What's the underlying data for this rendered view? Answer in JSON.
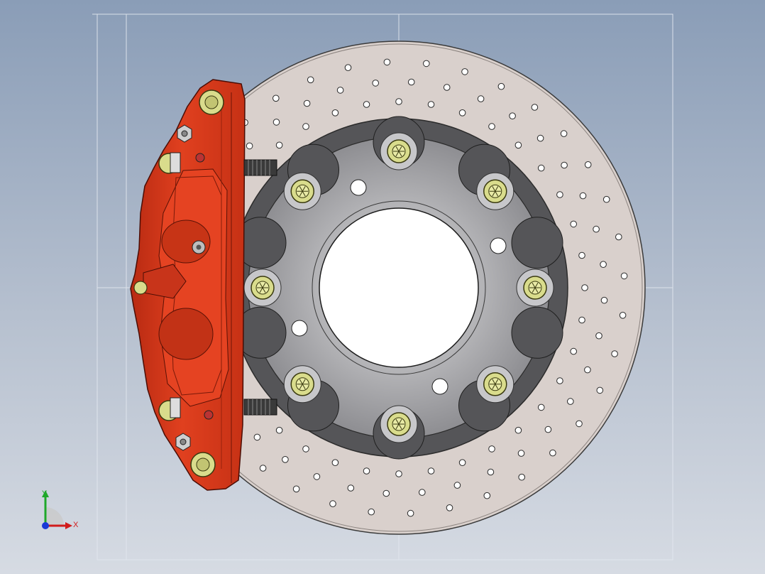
{
  "viewport": {
    "background_top": "#8a9db7",
    "background_bottom": "#d6dbe3"
  },
  "colors": {
    "caliper": "#d8371c",
    "caliper_dark": "#9b2410",
    "caliper_line": "#4a0d05",
    "rotor": "#d8cfcb",
    "rotor_edge": "#3a3a3a",
    "hat_ring": "#555558",
    "hat_face": "#a8a8ab",
    "bolt": "#d9dc8c",
    "bolt_dark": "#6e6f2c",
    "construction_line": "#e2e7ef"
  },
  "parts": {
    "rotor": "drilled-brake-rotor",
    "hat": "rotor-hat",
    "caliper": "brake-caliper",
    "bolts": "hat-bolts",
    "holes": "cross-drilled-holes"
  },
  "triad": {
    "x_label": "X",
    "y_label": "Y",
    "x_color": "#d11b1b",
    "y_color": "#1fa82a",
    "z_color": "#1a3ad6",
    "icon": "coordinate-triad-icon"
  }
}
